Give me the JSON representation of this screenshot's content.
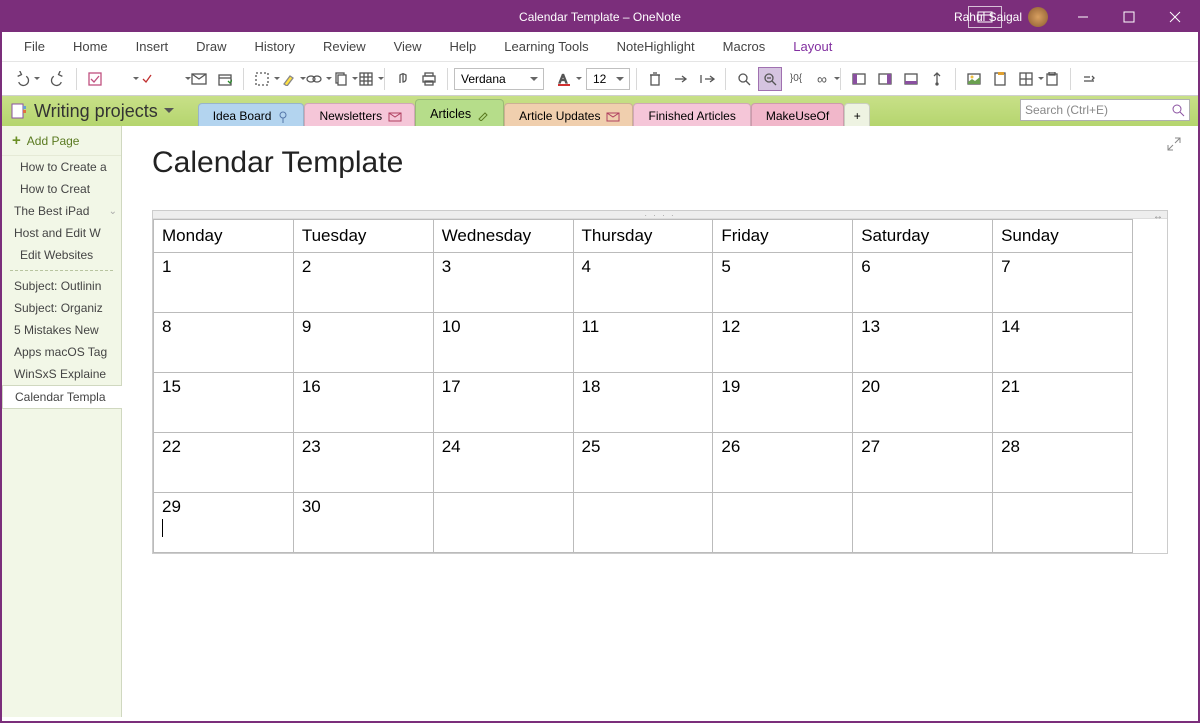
{
  "window": {
    "title": "Calendar Template  –  OneNote",
    "user": "Rahul Saigal"
  },
  "menu": {
    "items": [
      "File",
      "Home",
      "Insert",
      "Draw",
      "History",
      "Review",
      "View",
      "Help",
      "Learning Tools",
      "NoteHighlight",
      "Macros",
      "Layout"
    ],
    "active": "Layout"
  },
  "toolbar": {
    "font_name": "Verdana",
    "font_size": "12"
  },
  "notebook": {
    "name": "Writing projects",
    "sections": [
      {
        "label": "Idea Board",
        "color": "blue",
        "icon": "pin-icon"
      },
      {
        "label": "Newsletters",
        "color": "pink",
        "icon": "mail-icon"
      },
      {
        "label": "Articles",
        "color": "green",
        "icon": "pen-icon",
        "active": true
      },
      {
        "label": "Article Updates",
        "color": "orange",
        "icon": "mail-icon"
      },
      {
        "label": "Finished Articles",
        "color": "pink"
      },
      {
        "label": "MakeUseOf",
        "color": "rose"
      }
    ],
    "search_placeholder": "Search (Ctrl+E)"
  },
  "sidebar": {
    "add_label": "Add Page",
    "pages": [
      {
        "label": "How to Create a",
        "level": 1
      },
      {
        "label": "How to Creat",
        "level": 1
      },
      {
        "label": "The Best iPad",
        "level": 0,
        "chevron": true
      },
      {
        "label": "Host and Edit W",
        "level": 0
      },
      {
        "label": "Edit Websites",
        "level": 1
      },
      {
        "sep": true
      },
      {
        "label": "Subject: Outlinin",
        "level": 0
      },
      {
        "label": "Subject: Organiz",
        "level": 0
      },
      {
        "label": "5 Mistakes New",
        "level": 0
      },
      {
        "label": "Apps macOS Tag",
        "level": 0
      },
      {
        "label": "WinSxS Explaine",
        "level": 0
      },
      {
        "label": "Calendar Templa",
        "level": 0,
        "selected": true
      }
    ]
  },
  "page": {
    "title": "Calendar Template"
  },
  "calendar": {
    "headers": [
      "Monday",
      "Tuesday",
      "Wednesday",
      "Thursday",
      "Friday",
      "Saturday",
      "Sunday"
    ],
    "rows": [
      [
        "1",
        "2",
        "3",
        "4",
        "5",
        "6",
        "7"
      ],
      [
        "8",
        "9",
        "10",
        "11",
        "12",
        "13",
        "14"
      ],
      [
        "15",
        "16",
        "17",
        "18",
        "19",
        "20",
        "21"
      ],
      [
        "22",
        "23",
        "24",
        "25",
        "26",
        "27",
        "28"
      ],
      [
        "29",
        "30",
        "",
        "",
        "",
        "",
        ""
      ]
    ]
  }
}
